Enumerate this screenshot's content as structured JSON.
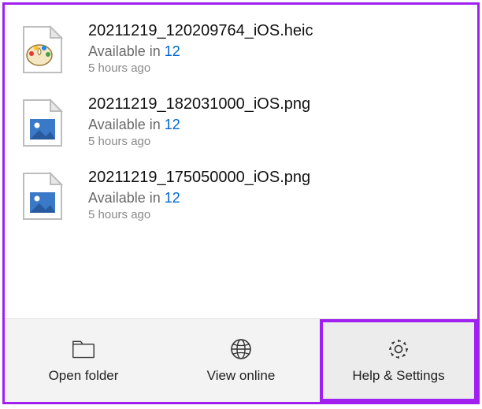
{
  "files": [
    {
      "name": "20211219_120209764_iOS.heic",
      "available_prefix": "Available in ",
      "available_count": "12",
      "time": "5 hours ago",
      "icon": "paint"
    },
    {
      "name": "20211219_182031000_iOS.png",
      "available_prefix": "Available in ",
      "available_count": "12",
      "time": "5 hours ago",
      "icon": "image"
    },
    {
      "name": "20211219_175050000_iOS.png",
      "available_prefix": "Available in ",
      "available_count": "12",
      "time": "5 hours ago",
      "icon": "image"
    }
  ],
  "bottom": {
    "open_folder": "Open folder",
    "view_online": "View online",
    "help_settings": "Help & Settings"
  }
}
